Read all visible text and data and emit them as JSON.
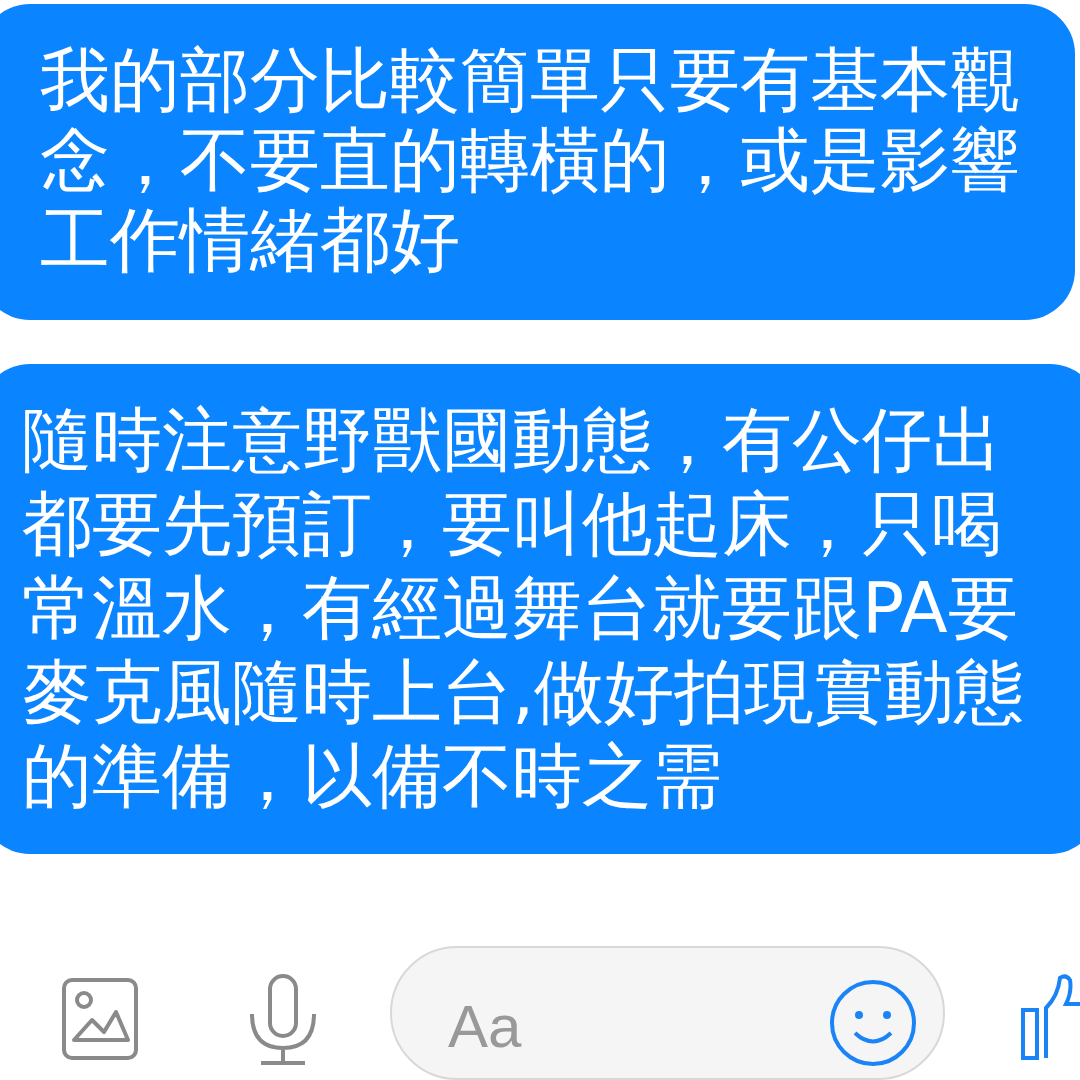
{
  "messages": [
    {
      "text": "我的部分比較簡單只要有基本觀念，不要直的轉橫的，或是影響工作情緒都好"
    },
    {
      "text": "隨時注意野獸國動態，有公仔出都要先預訂，要叫他起床，只喝常溫水，有經過舞台就要跟PA要麥克風隨時上台,做好拍現實動態的準備，以備不時之需"
    }
  ],
  "composer": {
    "placeholder": "Aa"
  }
}
